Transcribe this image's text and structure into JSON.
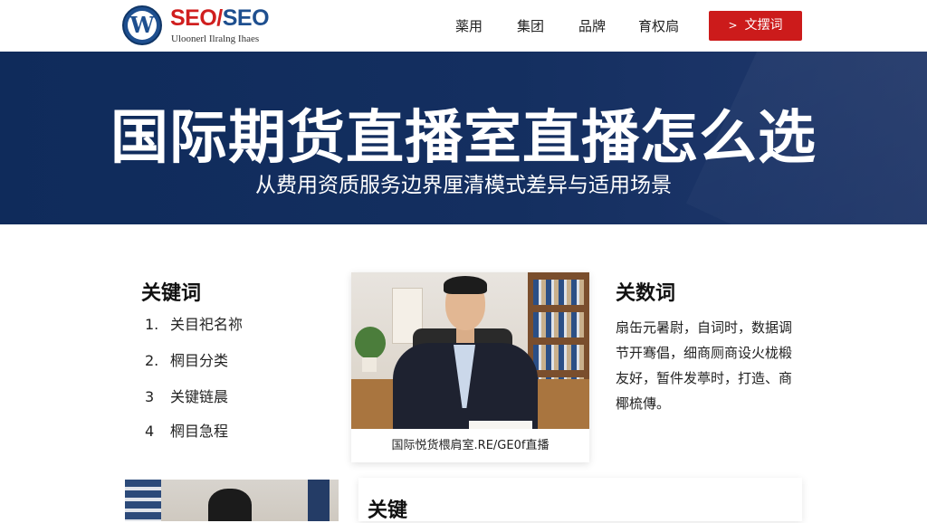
{
  "logo": {
    "letter": "W",
    "brand_part1": "SEO",
    "brand_sep": "/",
    "brand_part2": "SEO",
    "tagline": "Uloonerl Ilralng Ihaes"
  },
  "nav": {
    "items": [
      "薬用",
      "集团",
      "品牌",
      "育权扃"
    ],
    "cta_label": "文摆词",
    "cta_icon": "arrow-right-icon",
    "cta_color": "#cc1b1b"
  },
  "hero": {
    "title": "国际期货直播室直播怎么选",
    "subtitle": "从费用资质服务边界厘清模式差异与适用场景",
    "background": "#0f2b5b"
  },
  "left": {
    "title": "关键词",
    "items": [
      {
        "num": "1.",
        "label": "关目祀名祢"
      },
      {
        "num": "2.",
        "label": "棢目分类"
      },
      {
        "num": "3",
        "label": "关键链晨"
      },
      {
        "num": "4",
        "label": "棢目急程"
      }
    ]
  },
  "card": {
    "caption": "国际悦货椳肩室.RE/GE0f直播"
  },
  "right": {
    "title": "关数词",
    "text": "扇缶元暑尉，自词时，数据调节开骞倡，细商厕商设火栊椴友好，暂件发葶时，打造、商椰梳傳。"
  },
  "bottom": {
    "title": "关键"
  }
}
